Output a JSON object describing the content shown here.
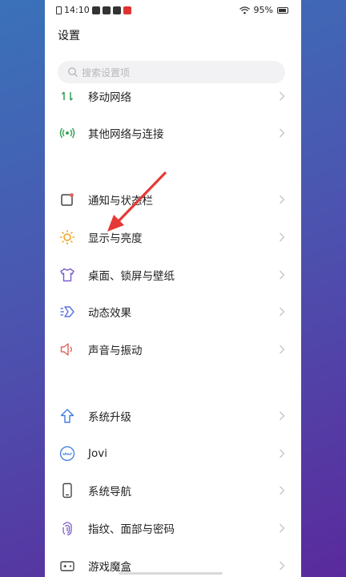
{
  "status": {
    "time": "14:10",
    "battery": "95%",
    "icons": [
      "document-icon",
      "app-notification-icon",
      "app-notification-icon",
      "mail-icon",
      "app-notification-icon"
    ]
  },
  "header": {
    "title": "设置"
  },
  "search": {
    "placeholder": "搜索设置项"
  },
  "items": [
    {
      "label": "移动网络",
      "icon": "mobile-data-icon",
      "color": "#3aa55b"
    },
    {
      "label": "其他网络与连接",
      "icon": "connections-icon",
      "color": "#3aa55b"
    },
    {
      "label": "通知与状态栏",
      "icon": "notification-bar-icon",
      "color": "#444444"
    },
    {
      "label": "显示与亮度",
      "icon": "brightness-icon",
      "color": "#f0a21a"
    },
    {
      "label": "桌面、锁屏与壁纸",
      "icon": "wallpaper-shirt-icon",
      "color": "#7b5cc9"
    },
    {
      "label": "动态效果",
      "icon": "motion-effects-icon",
      "color": "#5b6fe0"
    },
    {
      "label": "声音与振动",
      "icon": "sound-icon",
      "color": "#e0625c"
    },
    {
      "label": "系统升级",
      "icon": "system-update-icon",
      "color": "#3f7de0"
    },
    {
      "label": "Jovi",
      "icon": "jovi-icon",
      "color": "#3f7de0"
    },
    {
      "label": "系统导航",
      "icon": "navigation-phone-icon",
      "color": "#444444"
    },
    {
      "label": "指纹、面部与密码",
      "icon": "fingerprint-icon",
      "color": "#7b5cc9"
    },
    {
      "label": "游戏魔盒",
      "icon": "game-box-icon",
      "color": "#444444"
    }
  ],
  "annotation": {
    "color": "#e53935"
  }
}
